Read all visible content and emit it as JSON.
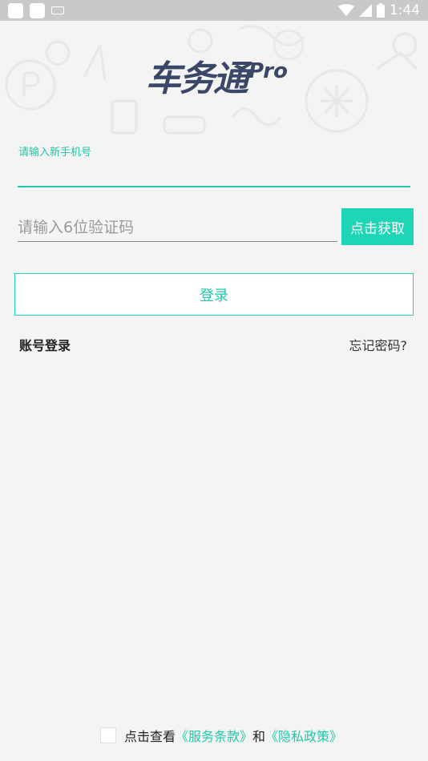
{
  "status_bar": {
    "time": "1:44",
    "icons": [
      "notification-square-icon",
      "notification-square-icon",
      "keyboard-icon",
      "wifi-icon",
      "signal-icon",
      "battery-icon"
    ]
  },
  "logo": {
    "main": "车务通",
    "suffix": "Pro"
  },
  "phone": {
    "label": "请输入新手机号",
    "value": ""
  },
  "code": {
    "placeholder": "请输入6位验证码",
    "button_label": "点击获取"
  },
  "login": {
    "button_label": "登录"
  },
  "links": {
    "account_login": "账号登录",
    "forgot_password": "忘记密码?"
  },
  "agreement": {
    "prefix": "点击查看",
    "terms": "《服务条款》",
    "and": "和",
    "privacy": "《隐私政策》",
    "checked": false
  },
  "colors": {
    "accent": "#1ed6b6",
    "logo": "#3b4767",
    "background": "#f4f4f4"
  }
}
